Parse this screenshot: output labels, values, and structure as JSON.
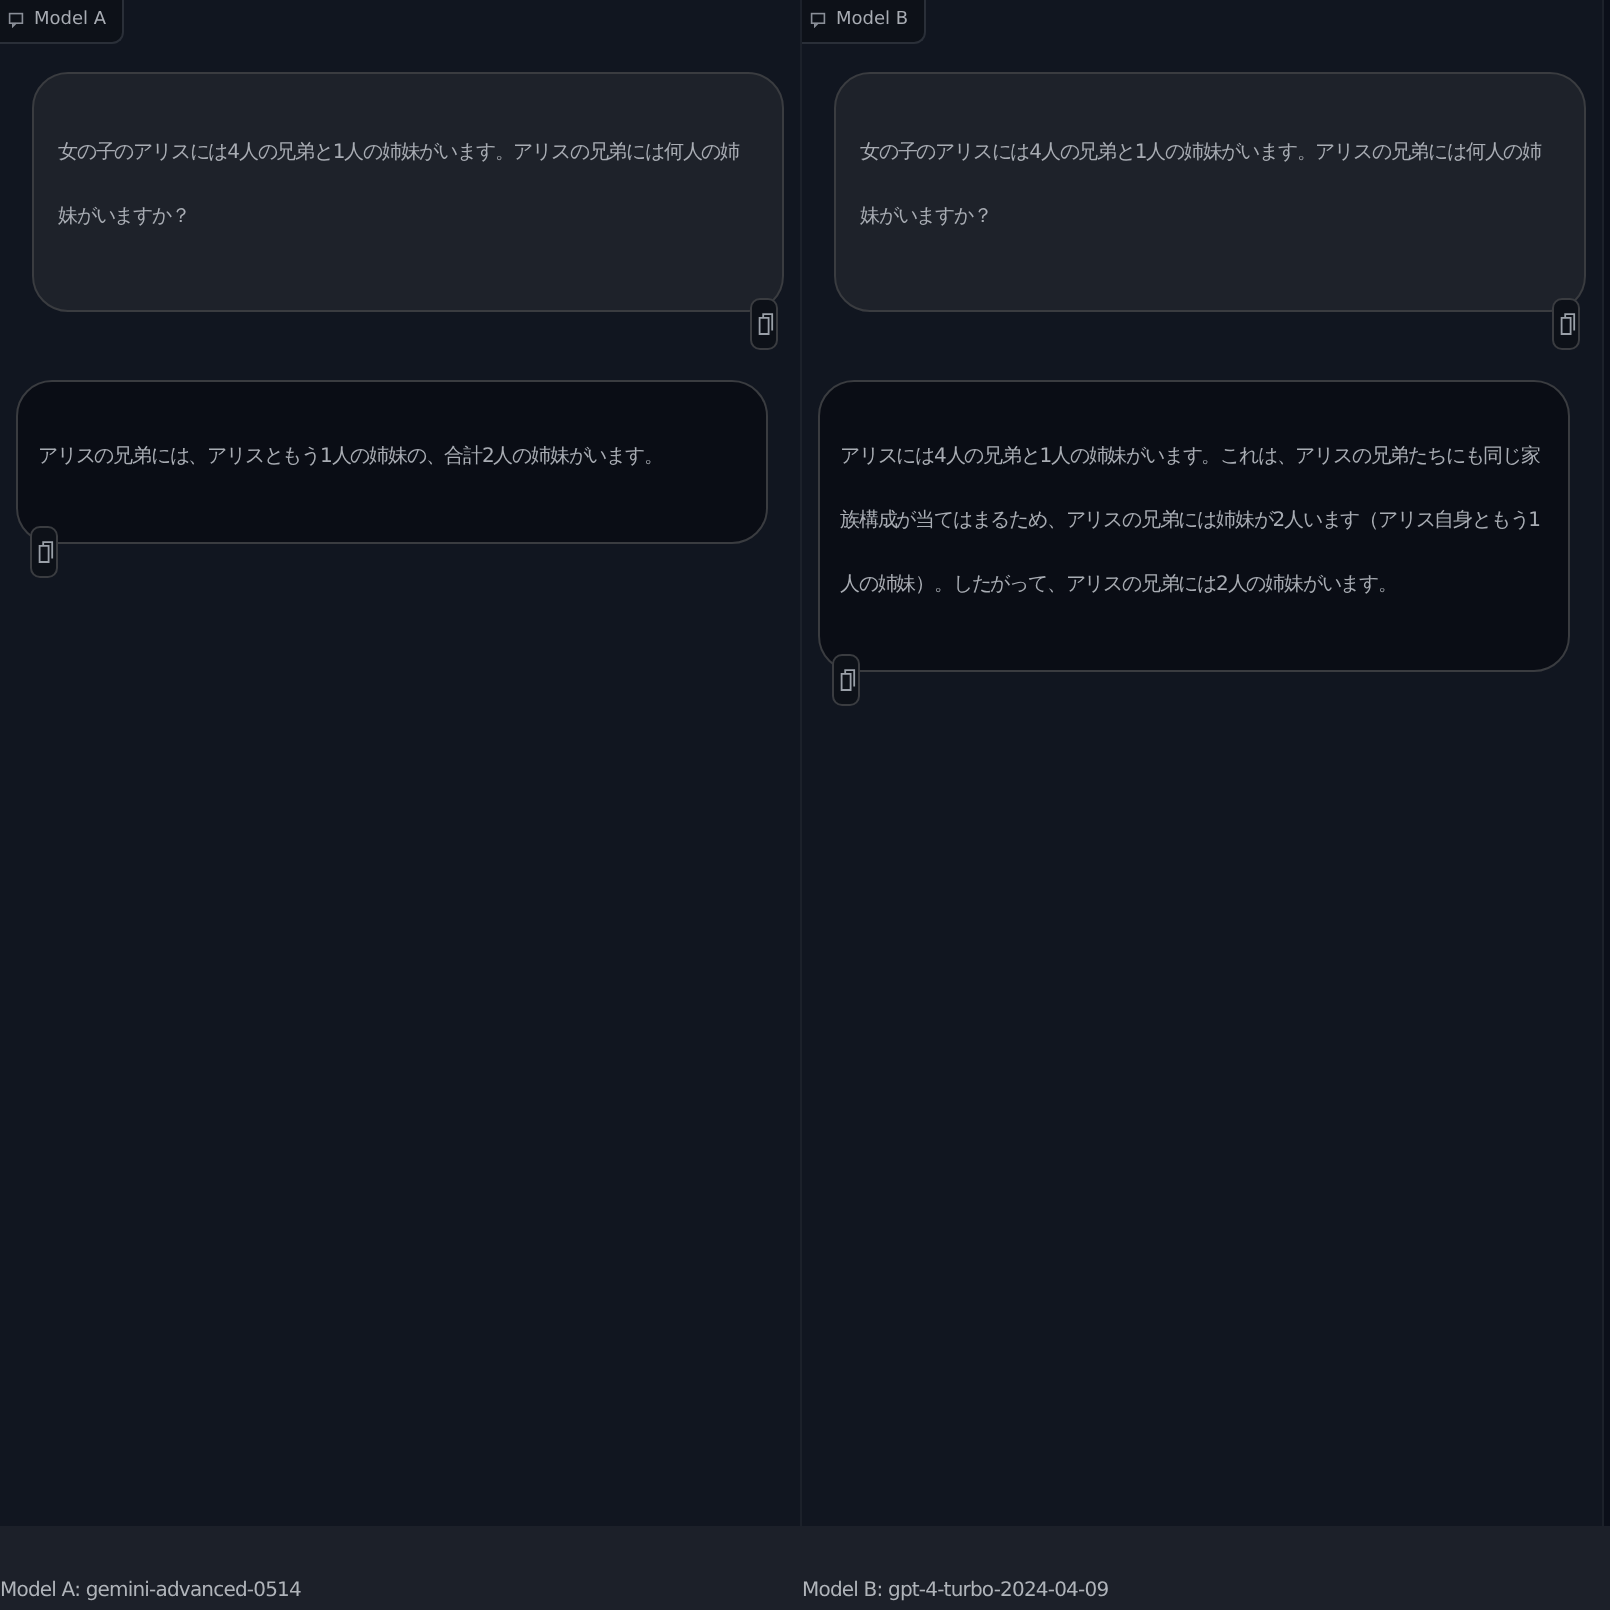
{
  "panels": [
    {
      "label": "Model A",
      "messages": [
        {
          "kind": "user",
          "text": "女の子のアリスには4人の兄弟と1人の姉妹がいます。アリスの兄弟には何人の姉妹がいますか？"
        },
        {
          "kind": "assistant",
          "text": "アリスの兄弟には、アリスともう1人の姉妹の、合計2人の姉妹がいます。"
        }
      ]
    },
    {
      "label": "Model B",
      "messages": [
        {
          "kind": "user",
          "text": "女の子のアリスには4人の兄弟と1人の姉妹がいます。アリスの兄弟には何人の姉妹がいますか？"
        },
        {
          "kind": "assistant",
          "text": "アリスには4人の兄弟と1人の姉妹がいます。これは、アリスの兄弟たちにも同じ家族構成が当てはまるため、アリスの兄弟には姉妹が2人います（アリス自身ともう1人の姉妹）。したがって、アリスの兄弟には2人の姉妹がいます。"
        }
      ]
    }
  ],
  "footer": [
    "Model A: gemini-advanced-0514",
    "Model B: gpt-4-turbo-2024-04-09"
  ]
}
